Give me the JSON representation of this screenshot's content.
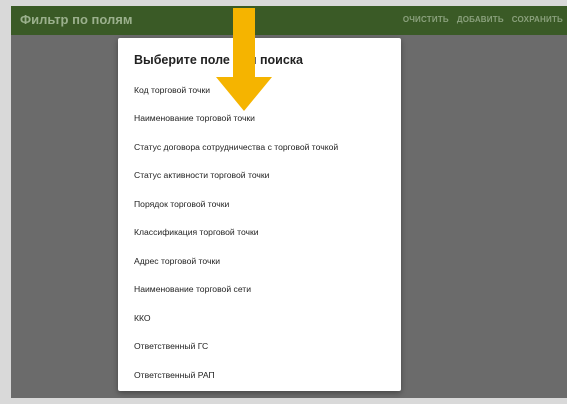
{
  "appbar": {
    "title": "Фильтр по полям",
    "actions": [
      "ОЧИСТИТЬ",
      "ДОБАВИТЬ",
      "СОХРАНИТЬ"
    ]
  },
  "dialog": {
    "title": "Выберите поле для поиска",
    "items": [
      "Код торговой точки",
      "Наименование торговой точки",
      "Статус договора сотрудничества с торговой точкой",
      "Статус активности торговой точки",
      "Порядок торговой точки",
      "Классификация торговой точки",
      "Адрес торговой точки",
      "Наименование торговой сети",
      "ККО",
      "Ответственный ГС",
      "Ответственный РАП"
    ]
  },
  "annotation": {
    "arrow_color": "#f5b400",
    "arrow_icon": "arrow-down-icon"
  },
  "colors": {
    "appbar": "#3a5a26",
    "overlay": "#6b6b6b",
    "dialog": "#ffffff"
  }
}
